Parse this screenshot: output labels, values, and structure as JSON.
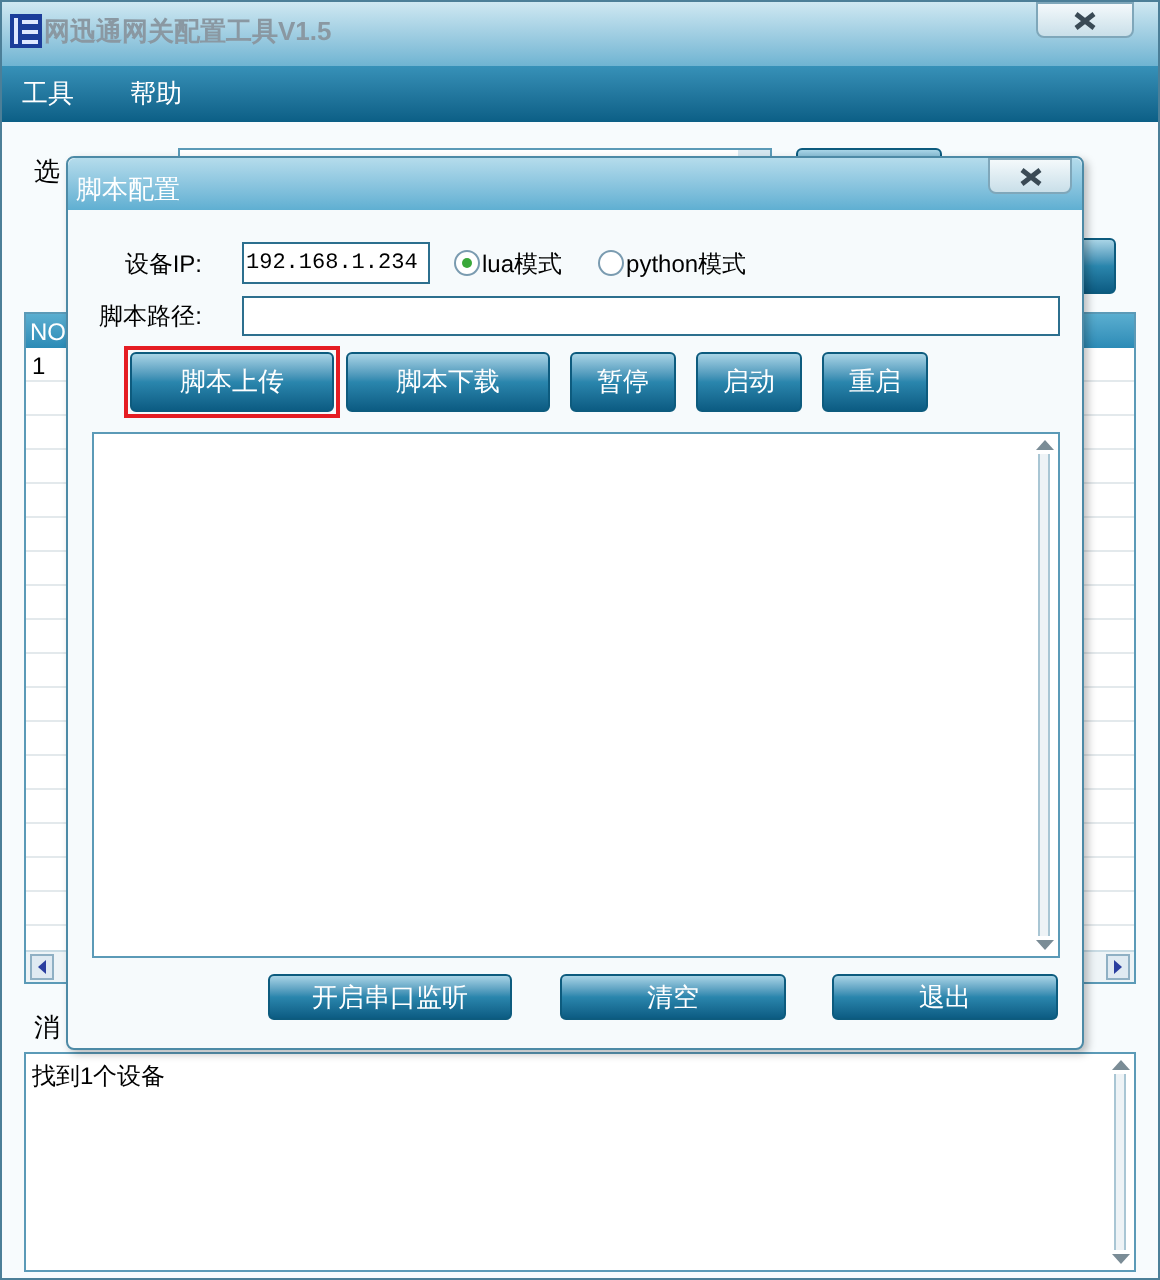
{
  "main_window": {
    "title": "网迅通网关配置工具V1.5",
    "menu": [
      {
        "label": "工具"
      },
      {
        "label": "帮助"
      }
    ],
    "select_label": "选",
    "table": {
      "columns": [
        "NO"
      ],
      "rows": [
        [
          "1"
        ]
      ]
    },
    "message_label": "消",
    "messages": [
      "找到1个设备"
    ]
  },
  "dialog": {
    "title": "脚本配置",
    "ip_label": "设备IP:",
    "ip_value": "192.168.1.234",
    "modes": [
      {
        "label": "lua模式",
        "selected": true
      },
      {
        "label": "python模式",
        "selected": false
      }
    ],
    "path_label": "脚本路径:",
    "actions": [
      {
        "label": "脚本上传",
        "highlighted": true
      },
      {
        "label": "脚本下载",
        "highlighted": false
      },
      {
        "label": "暂停",
        "highlighted": false
      },
      {
        "label": "启动",
        "highlighted": false
      },
      {
        "label": "重启",
        "highlighted": false
      }
    ],
    "footer_buttons": [
      "开启串口监听",
      "清空",
      "退出"
    ]
  }
}
